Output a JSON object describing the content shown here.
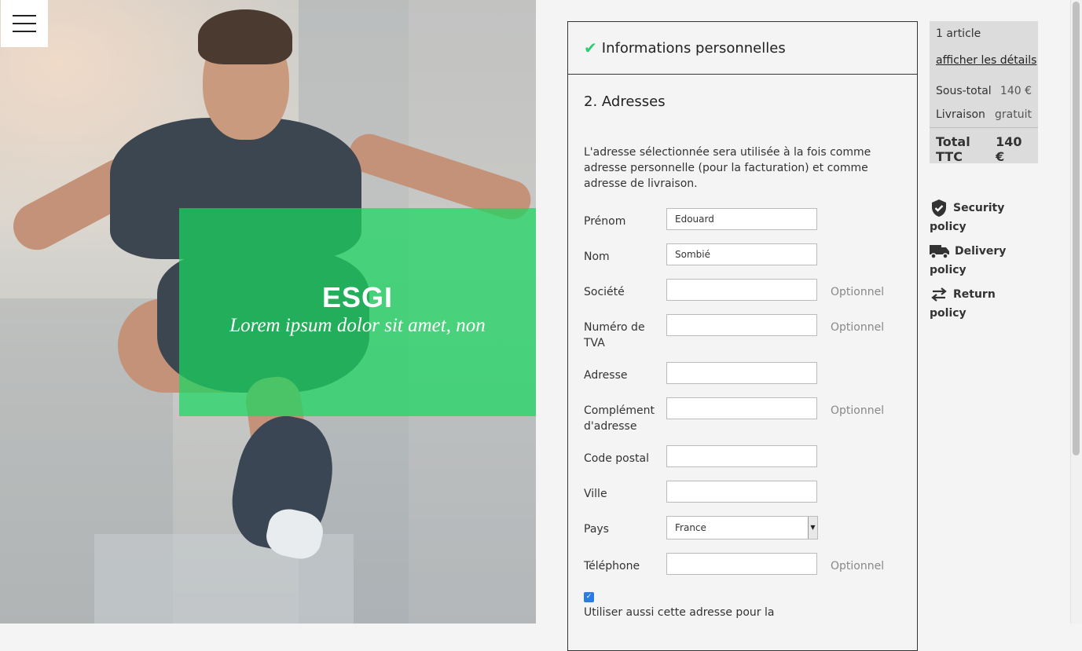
{
  "hero": {
    "title": "ESGI",
    "subtitle": "Lorem ipsum dolor sit amet, non"
  },
  "checkout": {
    "step1_label": "Informations personnelles",
    "step2_label": "2. Adresses",
    "description": "L'adresse sélectionnée sera utilisée à la fois comme adresse personnelle (pour la facturation) et comme adresse de livraison.",
    "optional_label": "Optionnel",
    "fields": {
      "prenom": {
        "label": "Prénom",
        "value": "Edouard"
      },
      "nom": {
        "label": "Nom",
        "value": "Sombié"
      },
      "societe": {
        "label": "Société",
        "value": ""
      },
      "tva": {
        "label": "Numéro de TVA",
        "value": ""
      },
      "adresse": {
        "label": "Adresse",
        "value": ""
      },
      "complement": {
        "label": "Complément d'adresse",
        "value": ""
      },
      "code_postal": {
        "label": "Code postal",
        "value": ""
      },
      "ville": {
        "label": "Ville",
        "value": ""
      },
      "pays": {
        "label": "Pays",
        "value": "France"
      },
      "telephone": {
        "label": "Téléphone",
        "value": ""
      }
    },
    "use_address_label": "Utiliser aussi cette adresse pour la",
    "use_address_checked": true
  },
  "summary": {
    "articles": "1 article",
    "details_link": "afficher les détails",
    "subtotal_label": "Sous-total",
    "subtotal_value": "140 €",
    "delivery_label": "Livraison",
    "delivery_value": "gratuit",
    "total_label": "Total TTC",
    "total_value": "140 €"
  },
  "policies": [
    {
      "label": "Security policy",
      "icon": "shield-check-icon"
    },
    {
      "label": "Delivery policy",
      "icon": "truck-icon"
    },
    {
      "label": "Return policy",
      "icon": "exchange-arrows-icon"
    }
  ],
  "colors": {
    "accent": "#1ad75f",
    "check": "#2ecc71",
    "panel_bg": "#f4f4f4",
    "summary_bg": "#dcdcdc"
  }
}
